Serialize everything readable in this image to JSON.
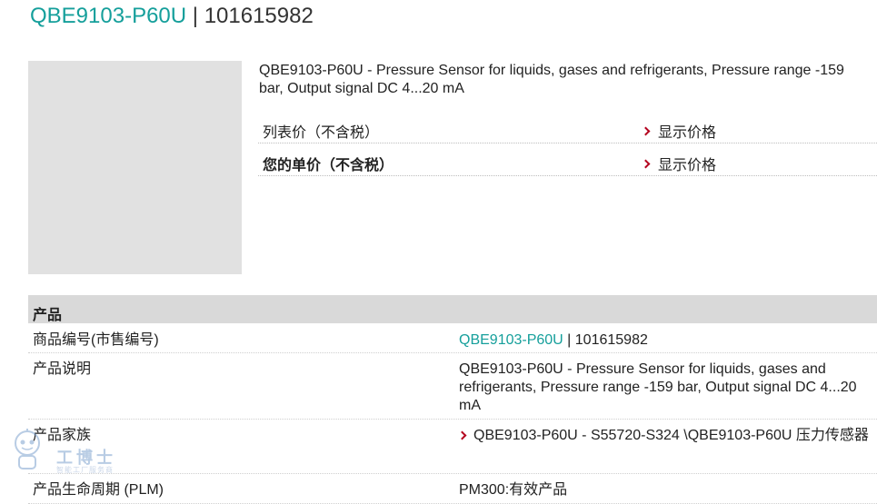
{
  "title": {
    "code": "QBE9103-P60U",
    "separator": "|",
    "number": "101615982"
  },
  "product": {
    "description": "QBE9103-P60U - Pressure Sensor for liquids, gases and refrigerants, Pressure range -159 bar, Output signal DC 4...20 mA"
  },
  "pricing": {
    "list_price_label": "列表价（不含税）",
    "list_price_link": "显示价格",
    "unit_price_label": "您的单价（不含税）",
    "unit_price_link": "显示价格"
  },
  "specs": {
    "header": "产品",
    "rows": [
      {
        "key": "商品编号(市售编号)",
        "value_code": "QBE9103-P60U",
        "value_sep": " | ",
        "value_num": "101615982"
      },
      {
        "key": "产品说明",
        "value": "QBE9103-P60U - Pressure Sensor for liquids, gases and refrigerants, Pressure range -159 bar, Output signal DC 4...20 mA"
      },
      {
        "key": "产品家族",
        "value": "QBE9103-P60U - S55720-S324 \\QBE9103-P60U 压力传感器"
      },
      {
        "key": "产品生命周期 (PLM)",
        "value": "PM300:有效产品"
      }
    ]
  },
  "watermark": {
    "title": "工博士",
    "subtitle": "智能工厂服务商",
    "icon": "robot-mascot-icon"
  },
  "colors": {
    "accent": "#159f9b",
    "chevron": "#b4001e",
    "header_bg": "#d9d9d9",
    "placeholder": "#e1e1e1"
  }
}
